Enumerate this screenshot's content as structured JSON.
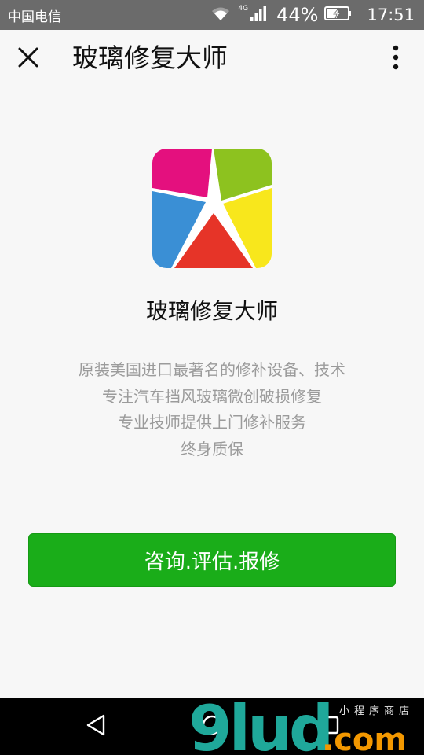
{
  "status_bar": {
    "carrier": "中国电信",
    "network_type": "4G",
    "battery_percent": "44%",
    "time": "17:51",
    "icons": [
      "wifi-icon",
      "signal-icon",
      "battery-charging-icon"
    ]
  },
  "toolbar": {
    "title": "玻璃修复大师",
    "close_icon": "close-icon",
    "more_icon": "more-vertical-icon"
  },
  "app": {
    "name": "玻璃修复大师",
    "logo_icon": "app-logo-icon",
    "description": [
      "原装美国进口最著名的修补设备、技术",
      "专注汽车挡风玻璃微创破损修复",
      "专业技师提供上门修补服务",
      "终身质保"
    ],
    "action_label": "咨询.评估.报修"
  },
  "colors": {
    "status_bar": "#6b6b6b",
    "background": "#f7f7f7",
    "primary_button": "#1aad19",
    "description_text": "#9b9b9b"
  },
  "nav_bar": {
    "icons": [
      "back-icon",
      "home-icon",
      "recent-apps-icon"
    ]
  },
  "watermark": {
    "brand": "9lud",
    "suffix": ".com",
    "tagline": "小程序商店"
  }
}
